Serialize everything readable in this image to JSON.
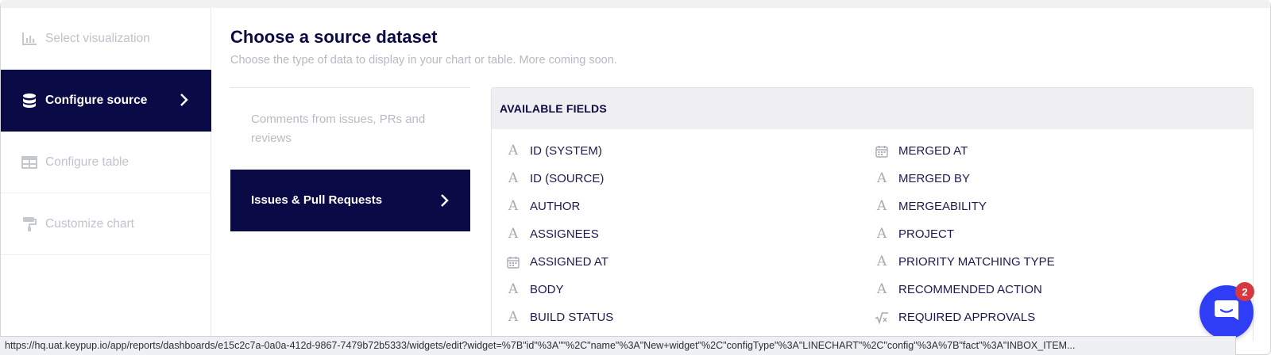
{
  "sidebar": {
    "steps": [
      {
        "label": "Select visualization",
        "icon": "bar-chart-icon",
        "active": false
      },
      {
        "label": "Configure source",
        "icon": "database-icon",
        "active": true
      },
      {
        "label": "Configure table",
        "icon": "table-icon",
        "active": false
      },
      {
        "label": "Customize chart",
        "icon": "paint-roller-icon",
        "active": false
      }
    ]
  },
  "main": {
    "title": "Choose a source dataset",
    "subtitle": "Choose the type of data to display in your chart or table. More coming soon.",
    "sources": [
      {
        "label": "Comments from issues, PRs and reviews",
        "selected": false
      },
      {
        "label": "Issues & Pull Requests",
        "selected": true
      }
    ]
  },
  "fields_panel": {
    "header": "AVAILABLE FIELDS",
    "left": [
      {
        "label": "ID (SYSTEM)",
        "icon": "text-type-icon"
      },
      {
        "label": "ID (SOURCE)",
        "icon": "text-type-icon"
      },
      {
        "label": "AUTHOR",
        "icon": "text-type-icon"
      },
      {
        "label": "ASSIGNEES",
        "icon": "text-type-icon"
      },
      {
        "label": "ASSIGNED AT",
        "icon": "calendar-icon"
      },
      {
        "label": "BODY",
        "icon": "text-type-icon"
      },
      {
        "label": "BUILD STATUS",
        "icon": "text-type-icon"
      }
    ],
    "right": [
      {
        "label": "MERGED AT",
        "icon": "calendar-icon"
      },
      {
        "label": "MERGED BY",
        "icon": "text-type-icon"
      },
      {
        "label": "MERGEABILITY",
        "icon": "text-type-icon"
      },
      {
        "label": "PROJECT",
        "icon": "text-type-icon"
      },
      {
        "label": "PRIORITY MATCHING TYPE",
        "icon": "text-type-icon"
      },
      {
        "label": "RECOMMENDED ACTION",
        "icon": "text-type-icon"
      },
      {
        "label": "REQUIRED APPROVALS",
        "icon": "formula-icon"
      }
    ]
  },
  "status_bar": {
    "url": "https://hq.uat.keypup.io/app/reports/dashboards/e15c2c7a-0a0a-412d-9867-7479b72b5333/widgets/edit?widget=%7B\"id\"%3A\"\"%2C\"name\"%3A\"New+widget\"%2C\"configType\"%3A\"LINECHART\"%2C\"config\"%3A%7B\"fact\"%3A\"INBOX_ITEM..."
  },
  "chat": {
    "badge_count": "2"
  },
  "colors": {
    "navy": "#0a0a47",
    "chat_blue": "#2f3df6",
    "badge_red": "#d6383f"
  }
}
